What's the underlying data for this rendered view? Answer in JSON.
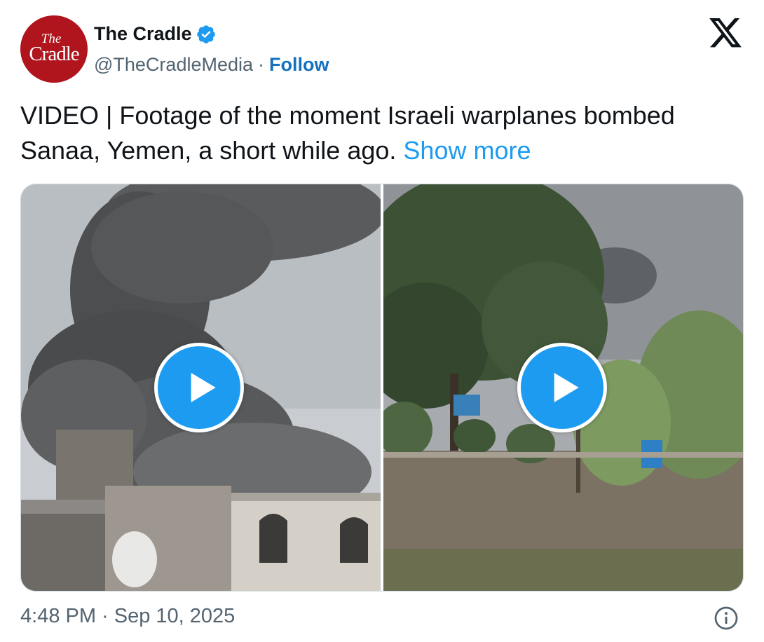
{
  "author": {
    "display_name": "The Cradle",
    "handle": "@TheCradleMedia",
    "separator": "·",
    "follow_label": "Follow",
    "avatar_text_top": "The",
    "avatar_text_bottom": "Cradle",
    "verified": true
  },
  "tweet": {
    "text": "VIDEO | Footage of the moment Israeli warplanes bombed Sanaa, Yemen, a short while ago.",
    "show_more_label": "Show more"
  },
  "media": {
    "items": [
      {
        "kind": "video",
        "icon": "play-icon"
      },
      {
        "kind": "video",
        "icon": "play-icon"
      }
    ]
  },
  "footer": {
    "timestamp": "4:48 PM · Sep 10, 2025",
    "info_icon": "info-icon"
  },
  "colors": {
    "accent": "#1d9bf0",
    "follow": "#1570c0",
    "muted": "#536471",
    "avatar_bg": "#b0141c"
  }
}
